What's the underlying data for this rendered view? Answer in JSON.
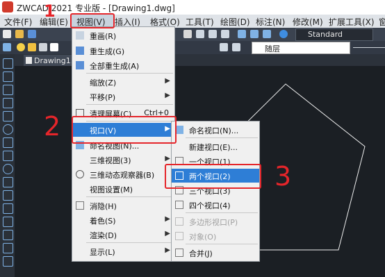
{
  "window": {
    "title": "ZWCAD 2021 专业版 - [Drawing1.dwg]"
  },
  "menubar": {
    "items": [
      "文件(F)",
      "编辑(E)",
      "视图(V)",
      "插入(I)",
      "格式(O)",
      "工具(T)",
      "绘图(D)",
      "标注(N)",
      "修改(M)",
      "扩展工具(X)",
      "窗"
    ]
  },
  "toolbar": {
    "text_style": "Standard",
    "layer": "随层"
  },
  "drawing_tab": {
    "label": "Drawing1.*"
  },
  "view_menu": {
    "items": [
      {
        "label": "重画(R)",
        "shortcut": "",
        "arrow": false
      },
      {
        "label": "重生成(G)",
        "shortcut": "",
        "arrow": false
      },
      {
        "label": "全部重生成(A)",
        "shortcut": "",
        "arrow": false
      },
      {
        "label": "缩放(Z)",
        "shortcut": "",
        "arrow": true
      },
      {
        "label": "平移(P)",
        "shortcut": "",
        "arrow": true
      },
      {
        "label": "清理屏幕(C)",
        "shortcut": "Ctrl+0",
        "arrow": false
      },
      {
        "label": "视口(V)",
        "shortcut": "",
        "arrow": true
      },
      {
        "label": "命名视图(N)...",
        "shortcut": "",
        "arrow": false
      },
      {
        "label": "三维视图(3)",
        "shortcut": "",
        "arrow": true
      },
      {
        "label": "三维动态观察器(B)",
        "shortcut": "",
        "arrow": false
      },
      {
        "label": "视图设置(M)",
        "shortcut": "",
        "arrow": false
      },
      {
        "label": "消隐(H)",
        "shortcut": "",
        "arrow": false
      },
      {
        "label": "着色(S)",
        "shortcut": "",
        "arrow": true
      },
      {
        "label": "渲染(D)",
        "shortcut": "",
        "arrow": true
      },
      {
        "label": "显示(L)",
        "shortcut": "",
        "arrow": true
      }
    ]
  },
  "viewport_menu": {
    "items": [
      {
        "label": "命名视口(N)..."
      },
      {
        "label": "新建视口(E)..."
      },
      {
        "label": "一个视口(1)"
      },
      {
        "label": "两个视口(2)"
      },
      {
        "label": "三个视口(3)"
      },
      {
        "label": "四个视口(4)"
      },
      {
        "label": "多边形视口(P)"
      },
      {
        "label": "对象(O)"
      },
      {
        "label": "合并(J)"
      }
    ]
  },
  "annotations": {
    "step1": "1",
    "step2": "2",
    "step3": "3"
  },
  "colors": {
    "accent": "#2e7ed6",
    "annotation": "#e5252a"
  }
}
